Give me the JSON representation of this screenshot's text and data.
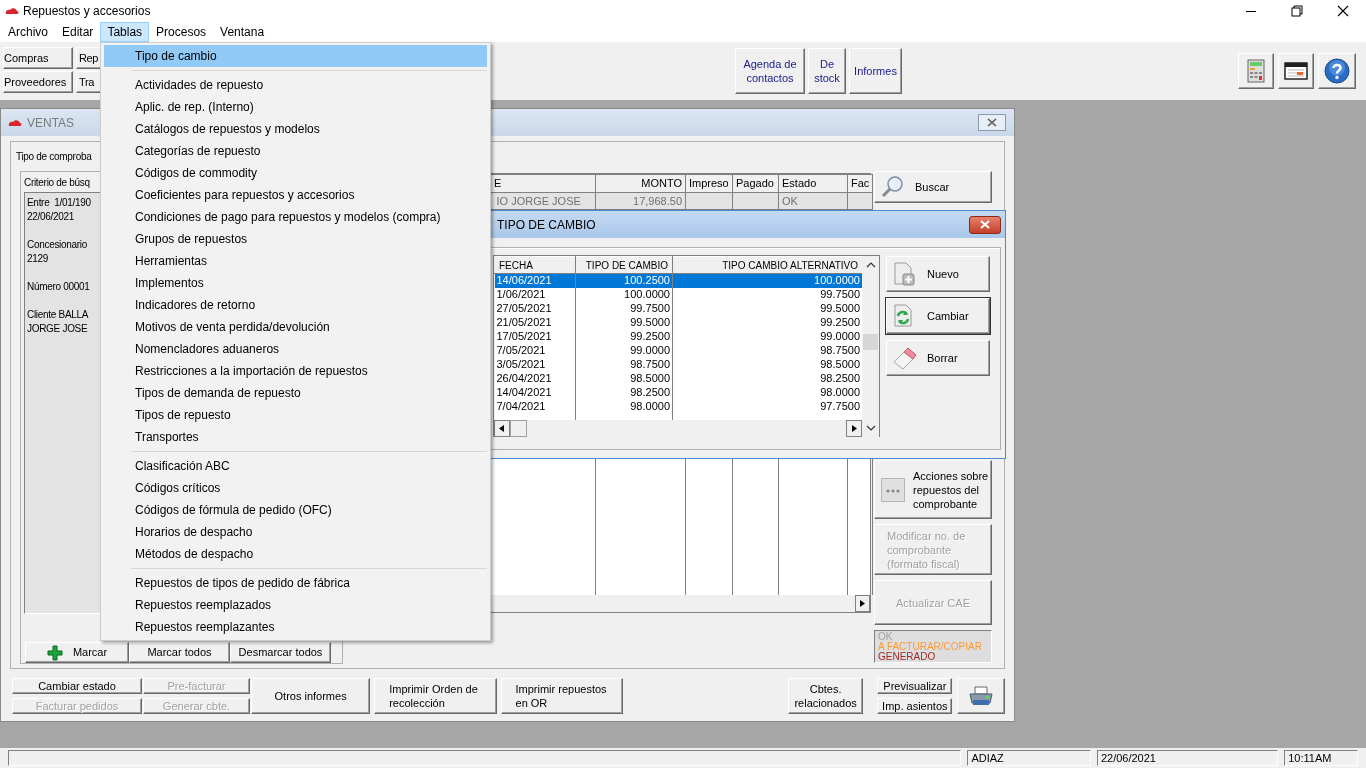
{
  "window": {
    "title": "Repuestos y accesorios"
  },
  "menu_bar": [
    {
      "label": "Archivo",
      "selected": false
    },
    {
      "label": "Editar",
      "selected": false
    },
    {
      "label": "Tablas",
      "selected": true
    },
    {
      "label": "Procesos",
      "selected": false
    },
    {
      "label": "Ventana",
      "selected": false
    }
  ],
  "toolbar": {
    "left_rows": [
      [
        "Compras",
        "Rep"
      ],
      [
        "Proveedores",
        "Tra"
      ]
    ],
    "center_buttons": [
      "Agenda de contactos",
      "De stock",
      "Informes"
    ]
  },
  "open_menu": {
    "sections": [
      [
        {
          "label": "Tipo de cambio",
          "selected": true
        }
      ],
      [
        {
          "label": "Actividades de repuesto",
          "selected": false
        },
        {
          "label": "Aplic. de rep. (Interno)",
          "selected": false
        },
        {
          "label": "Catálogos de repuestos y modelos",
          "selected": false
        },
        {
          "label": "Categorías de repuesto",
          "selected": false
        },
        {
          "label": "Códigos de commodity",
          "selected": false
        },
        {
          "label": "Coeficientes para repuestos y accesorios",
          "selected": false
        },
        {
          "label": "Condiciones de pago para repuestos y modelos (compra)",
          "selected": false
        },
        {
          "label": "Grupos de repuestos",
          "selected": false
        },
        {
          "label": "Herramientas",
          "selected": false
        },
        {
          "label": "Implementos",
          "selected": false
        },
        {
          "label": "Indicadores de retorno",
          "selected": false
        },
        {
          "label": "Motivos de venta perdida/devolución",
          "selected": false
        },
        {
          "label": "Nomencladores aduaneros",
          "selected": false
        },
        {
          "label": "Restricciones a la importación de repuestos",
          "selected": false
        },
        {
          "label": "Tipos de demanda de repuesto",
          "selected": false
        },
        {
          "label": "Tipos de repuesto",
          "selected": false
        },
        {
          "label": "Transportes",
          "selected": false
        }
      ],
      [
        {
          "label": "Clasificación ABC",
          "selected": false
        },
        {
          "label": "Códigos críticos",
          "selected": false
        },
        {
          "label": "Códigos de fórmula de pedido (OFC)",
          "selected": false
        },
        {
          "label": "Horarios de despacho",
          "selected": false
        },
        {
          "label": "Métodos de despacho",
          "selected": false
        }
      ],
      [
        {
          "label": "Repuestos de tipos de pedido de fábrica",
          "selected": false
        },
        {
          "label": "Repuestos reemplazados",
          "selected": false
        },
        {
          "label": "Repuestos reemplazantes",
          "selected": false
        }
      ]
    ]
  },
  "ventas": {
    "title": "VENTAS",
    "tipo_label": "Tipo de comproba",
    "criteria": {
      "title": "Criterio de búsq",
      "paragraphs": [
        [
          "Entre  1/01/190",
          "22/06/2021"
        ],
        [
          "Concesionario",
          "2129"
        ],
        [
          "Número 00001"
        ],
        [
          "Cliente BALLA",
          "JORGE JOSE"
        ]
      ]
    },
    "mark_buttons": [
      {
        "label": "Marcar",
        "kind": "plus"
      },
      {
        "label": "Marcar todos",
        "kind": "plain"
      },
      {
        "label": "Desmarcar todos",
        "kind": "plain"
      }
    ],
    "grid": {
      "columns": [
        "E",
        "MONTO",
        "Impreso",
        "Pagado",
        "Estado",
        "Fac"
      ],
      "rows": [
        {
          "column_1": "IO JORGE JOSE",
          "monto": "17,968.50",
          "estado": "OK"
        }
      ]
    },
    "side_buttons": [
      {
        "label": "Buscar",
        "kind": "search",
        "disabled": false
      },
      {
        "label": "Acciones sobre repuestos del comprobante",
        "kind": "actions",
        "disabled": false
      },
      {
        "label": "Modificar no. de comprobante (formato fiscal)",
        "kind": "plain",
        "disabled": true
      },
      {
        "label": "Actualizar CAE",
        "kind": "plain",
        "disabled": true
      }
    ],
    "legend": [
      {
        "label": "OK",
        "color": "#a0a0a0"
      },
      {
        "label": "A FACTURAR/COPIAR",
        "color": "#ff9933"
      },
      {
        "label": "GENERADO",
        "color": "#a52a2a"
      }
    ],
    "bottom_bar": {
      "left_grid": [
        {
          "label": "Cambiar estado",
          "disabled": false
        },
        {
          "label": "Pre-facturar",
          "disabled": true
        },
        {
          "label": "Facturar pedidos",
          "disabled": true
        },
        {
          "label": "Generar cbte.",
          "disabled": true
        }
      ],
      "middle_buttons": [
        "Otros informes",
        "Imprimir Orden de recolección",
        "Imprimir repuestos en OR"
      ],
      "right_buttons": [
        "Cbtes. relacionados"
      ],
      "print_options": [
        "Previsualizar",
        "Imp. asientos"
      ]
    }
  },
  "dialog": {
    "title": "TIPO DE CAMBIO",
    "columns": [
      "FECHA",
      "TIPO DE CAMBIO",
      "TIPO CAMBIO ALTERNATIVO"
    ],
    "rows": [
      {
        "fecha": "14/06/2021",
        "tipo_de_cambio": "100.2500",
        "alternativo": "100.0000",
        "selected": true
      },
      {
        "fecha": "1/06/2021",
        "tipo_de_cambio": "100.0000",
        "alternativo": "99.7500",
        "selected": false
      },
      {
        "fecha": "27/05/2021",
        "tipo_de_cambio": "99.7500",
        "alternativo": "99.5000",
        "selected": false
      },
      {
        "fecha": "21/05/2021",
        "tipo_de_cambio": "99.5000",
        "alternativo": "99.2500",
        "selected": false
      },
      {
        "fecha": "17/05/2021",
        "tipo_de_cambio": "99.2500",
        "alternativo": "99.0000",
        "selected": false
      },
      {
        "fecha": "7/05/2021",
        "tipo_de_cambio": "99.0000",
        "alternativo": "98.7500",
        "selected": false
      },
      {
        "fecha": "3/05/2021",
        "tipo_de_cambio": "98.7500",
        "alternativo": "98.5000",
        "selected": false
      },
      {
        "fecha": "26/04/2021",
        "tipo_de_cambio": "98.5000",
        "alternativo": "98.2500",
        "selected": false
      },
      {
        "fecha": "14/04/2021",
        "tipo_de_cambio": "98.2500",
        "alternativo": "98.0000",
        "selected": false
      },
      {
        "fecha": "7/04/2021",
        "tipo_de_cambio": "98.0000",
        "alternativo": "97.7500",
        "selected": false
      }
    ],
    "buttons": [
      {
        "label": "Nuevo",
        "kind": "new",
        "default": false
      },
      {
        "label": "Cambiar",
        "kind": "refresh",
        "default": true
      },
      {
        "label": "Borrar",
        "kind": "erase",
        "default": false
      }
    ]
  },
  "status_bar": {
    "user": "ADIAZ",
    "date": "22/06/2021",
    "time": "10:11AM"
  }
}
